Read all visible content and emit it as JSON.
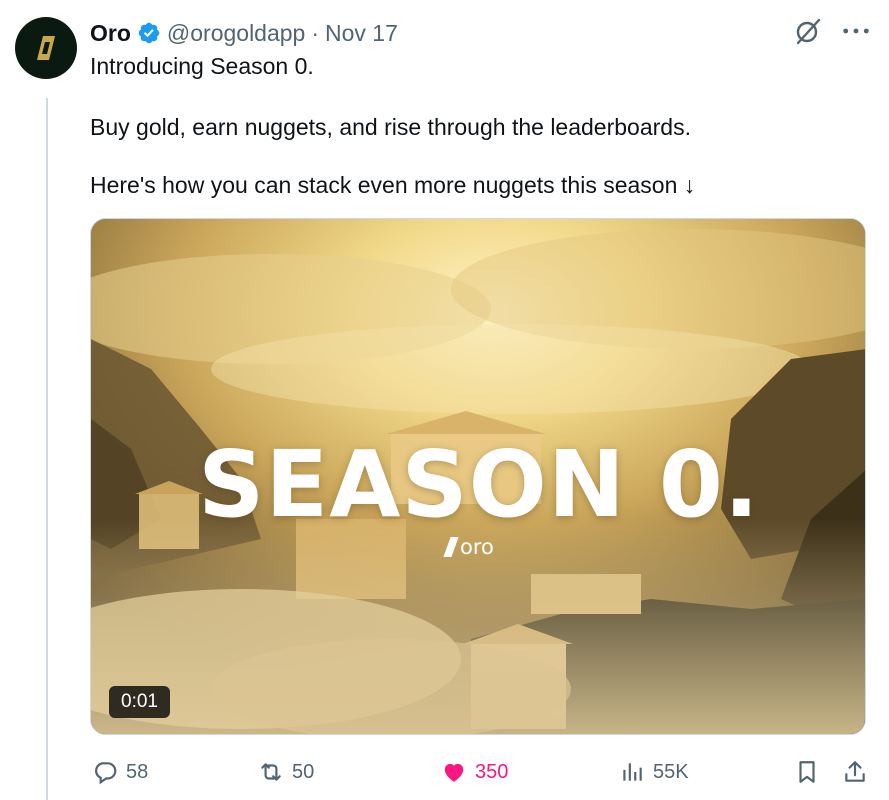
{
  "author": {
    "name": "Oro",
    "handle": "@orogoldapp",
    "separator": "·",
    "date": "Nov 17",
    "verified": true,
    "avatar_icon": "oro-logo-icon"
  },
  "tweet": {
    "lines": [
      "Introducing Season 0.",
      "Buy gold, earn nuggets, and rise through the leaderboards.",
      "Here's how you can stack even more nuggets this season ↓"
    ]
  },
  "media": {
    "title": "SEASON 0.",
    "brand": "oro",
    "timestamp": "0:01"
  },
  "actions": {
    "replies": "58",
    "retweets": "50",
    "likes": "350",
    "views": "55K"
  },
  "colors": {
    "verified": "#1d9bf0",
    "like": "#f91880",
    "muted": "#536471"
  }
}
